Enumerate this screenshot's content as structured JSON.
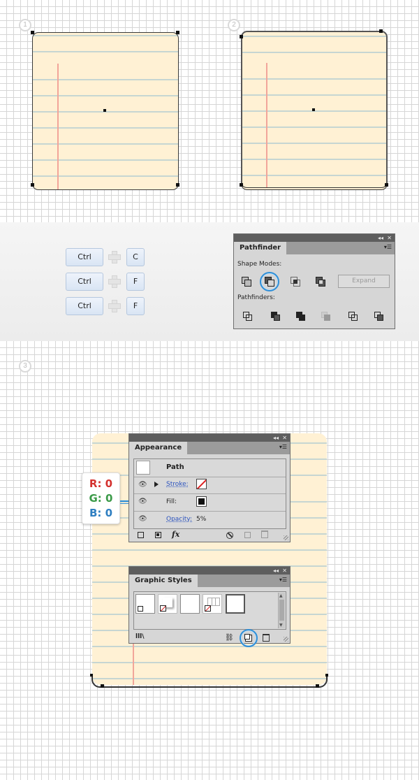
{
  "steps": {
    "s1": "1",
    "s2": "2",
    "s3": "3"
  },
  "keyboard": {
    "rows": [
      {
        "mod": "Ctrl",
        "key": "C"
      },
      {
        "mod": "Ctrl",
        "key": "F"
      },
      {
        "mod": "Ctrl",
        "key": "F"
      }
    ]
  },
  "pathfinder": {
    "title": "Pathfinder",
    "shape_modes_label": "Shape Modes:",
    "expand_label": "Expand",
    "pathfinders_label": "Pathfinders:",
    "collapse_glyph": "◂◂",
    "close_glyph": "✕",
    "menu_glyph": "▾☰"
  },
  "appearance": {
    "title": "Appearance",
    "object_label": "Path",
    "stroke_label": "Stroke:",
    "fill_label": "Fill:",
    "opacity_label": "Opacity:",
    "opacity_value": "5%",
    "fx_label": "fx"
  },
  "graphic_styles": {
    "title": "Graphic Styles",
    "library_label": "lll\\"
  },
  "color_callout": {
    "r": "R: 0",
    "g": "G: 0",
    "b": "B: 0"
  },
  "colors": {
    "paper": "#fff1d4",
    "rule": "#c6d6d2",
    "margin": "#f2a59a",
    "highlight": "#2f8fd8"
  }
}
